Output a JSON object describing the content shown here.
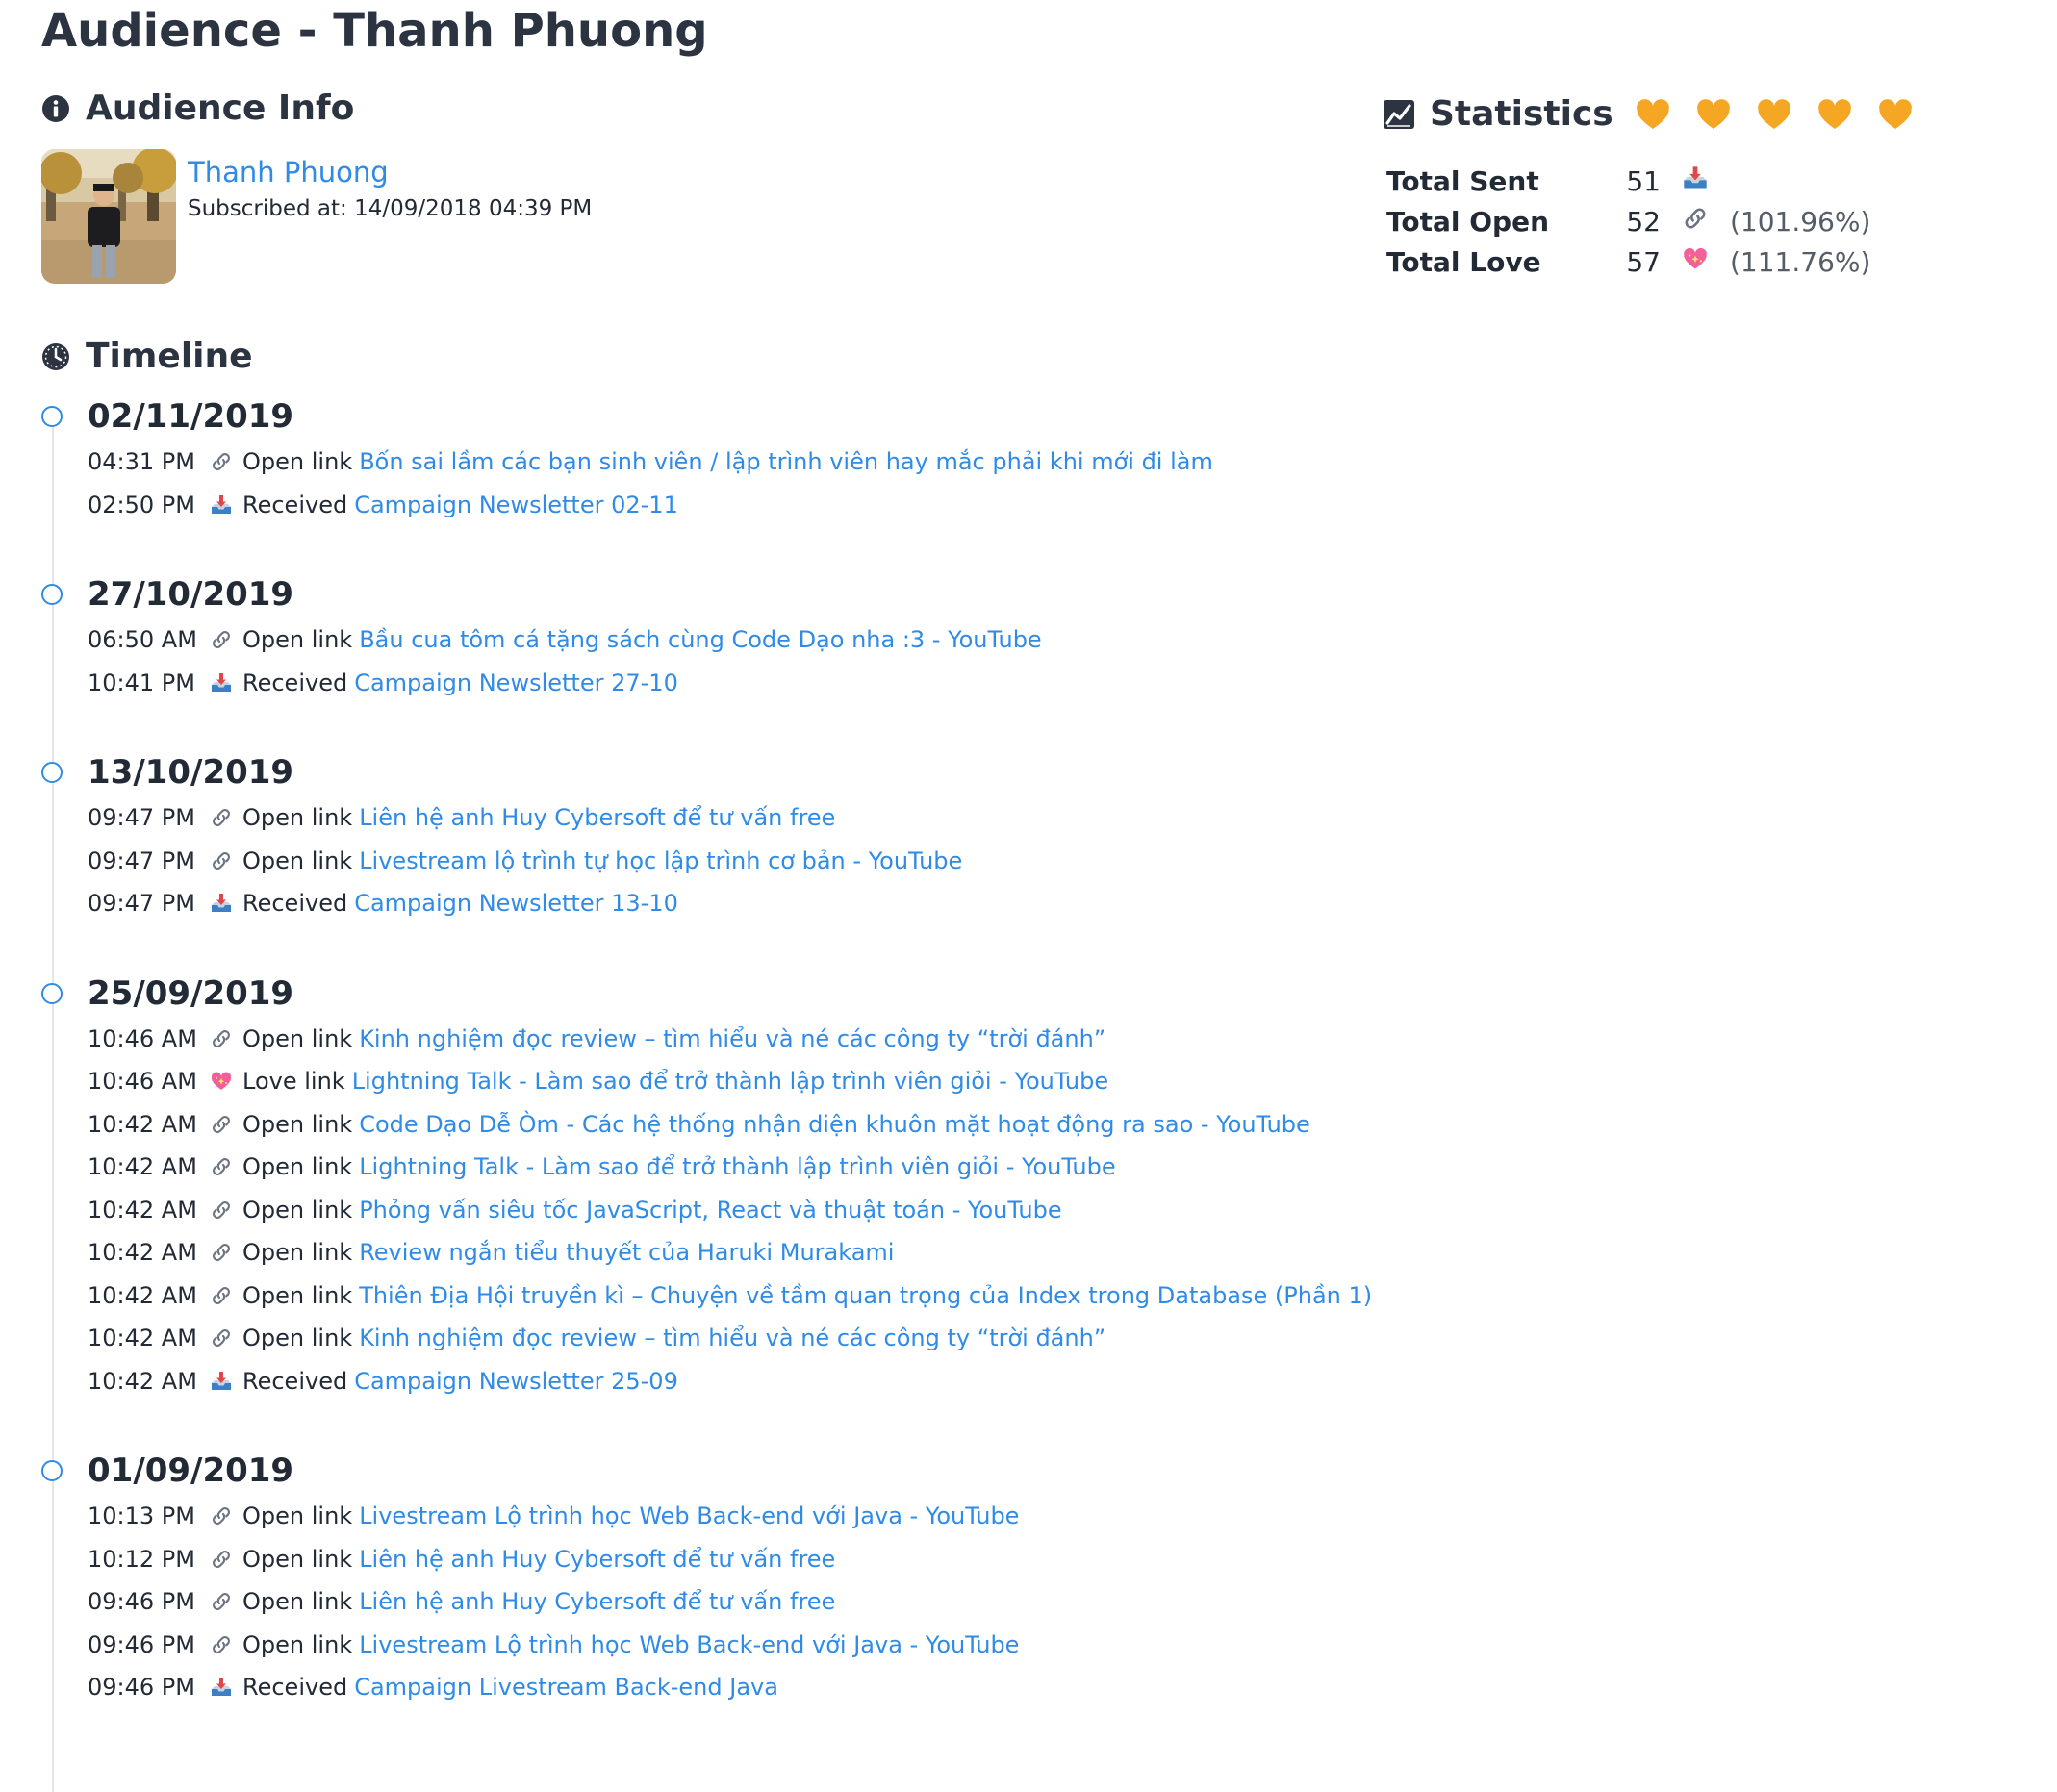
{
  "page": {
    "title": "Audience - Thanh Phuong"
  },
  "audience": {
    "heading": "Audience Info",
    "name": "Thanh Phuong",
    "subscribed": "Subscribed at: 14/09/2018 04:39 PM"
  },
  "statistics": {
    "heading": "Statistics",
    "hearts": 5,
    "rows": [
      {
        "label": "Total Sent",
        "value": "51",
        "icon": "inbox-tray-icon",
        "pct": ""
      },
      {
        "label": "Total Open",
        "value": "52",
        "icon": "link-icon",
        "pct": "(101.96%)"
      },
      {
        "label": "Total Love",
        "value": "57",
        "icon": "sparkling-heart-icon",
        "pct": "(111.76%)"
      }
    ]
  },
  "timeline": {
    "heading": "Timeline",
    "groups": [
      {
        "date": "02/11/2019",
        "events": [
          {
            "time": "04:31 PM",
            "icon": "link-icon",
            "action": "Open link",
            "target": "Bốn sai lầm các bạn sinh viên / lập trình viên hay mắc phải khi mới đi làm"
          },
          {
            "time": "02:50 PM",
            "icon": "inbox-tray-icon",
            "action": "Received",
            "target": "Campaign Newsletter 02-11"
          }
        ]
      },
      {
        "date": "27/10/2019",
        "events": [
          {
            "time": "06:50 AM",
            "icon": "link-icon",
            "action": "Open link",
            "target": "Bầu cua tôm cá tặng sách cùng Code Dạo nha :3 - YouTube"
          },
          {
            "time": "10:41 PM",
            "icon": "inbox-tray-icon",
            "action": "Received",
            "target": "Campaign Newsletter 27-10"
          }
        ]
      },
      {
        "date": "13/10/2019",
        "events": [
          {
            "time": "09:47 PM",
            "icon": "link-icon",
            "action": "Open link",
            "target": "Liên hệ anh Huy Cybersoft để tư vấn free"
          },
          {
            "time": "09:47 PM",
            "icon": "link-icon",
            "action": "Open link",
            "target": "Livestream lộ trình tự học lập trình cơ bản - YouTube"
          },
          {
            "time": "09:47 PM",
            "icon": "inbox-tray-icon",
            "action": "Received",
            "target": "Campaign Newsletter 13-10"
          }
        ]
      },
      {
        "date": "25/09/2019",
        "events": [
          {
            "time": "10:46 AM",
            "icon": "link-icon",
            "action": "Open link",
            "target": "Kinh nghiệm đọc review – tìm hiểu và né các công ty “trời đánh”"
          },
          {
            "time": "10:46 AM",
            "icon": "sparkling-heart-icon",
            "action": "Love link",
            "target": "Lightning Talk - Làm sao để trở thành lập trình viên giỏi - YouTube"
          },
          {
            "time": "10:42 AM",
            "icon": "link-icon",
            "action": "Open link",
            "target": "Code Dạo Dễ Òm - Các hệ thống nhận diện khuôn mặt hoạt động ra sao - YouTube"
          },
          {
            "time": "10:42 AM",
            "icon": "link-icon",
            "action": "Open link",
            "target": "Lightning Talk - Làm sao để trở thành lập trình viên giỏi - YouTube"
          },
          {
            "time": "10:42 AM",
            "icon": "link-icon",
            "action": "Open link",
            "target": "Phỏng vấn siêu tốc JavaScript, React và thuật toán - YouTube"
          },
          {
            "time": "10:42 AM",
            "icon": "link-icon",
            "action": "Open link",
            "target": "Review ngắn tiểu thuyết của Haruki Murakami"
          },
          {
            "time": "10:42 AM",
            "icon": "link-icon",
            "action": "Open link",
            "target": "Thiên Địa Hội truyền kì – Chuyện về tầm quan trọng của Index trong Database (Phần 1)"
          },
          {
            "time": "10:42 AM",
            "icon": "link-icon",
            "action": "Open link",
            "target": "Kinh nghiệm đọc review – tìm hiểu và né các công ty “trời đánh”"
          },
          {
            "time": "10:42 AM",
            "icon": "inbox-tray-icon",
            "action": "Received",
            "target": "Campaign Newsletter 25-09"
          }
        ]
      },
      {
        "date": "01/09/2019",
        "events": [
          {
            "time": "10:13 PM",
            "icon": "link-icon",
            "action": "Open link",
            "target": "Livestream Lộ trình học Web Back-end với Java - YouTube"
          },
          {
            "time": "10:12 PM",
            "icon": "link-icon",
            "action": "Open link",
            "target": "Liên hệ anh Huy Cybersoft để tư vấn free"
          },
          {
            "time": "09:46 PM",
            "icon": "link-icon",
            "action": "Open link",
            "target": "Liên hệ anh Huy Cybersoft để tư vấn free"
          },
          {
            "time": "09:46 PM",
            "icon": "link-icon",
            "action": "Open link",
            "target": "Livestream Lộ trình học Web Back-end với Java - YouTube"
          },
          {
            "time": "09:46 PM",
            "icon": "inbox-tray-icon",
            "action": "Received",
            "target": "Campaign Livestream Back-end Java"
          }
        ]
      }
    ]
  },
  "colors": {
    "accent": "#2f8be6",
    "heart": "#f5a623",
    "text": "#222a35"
  }
}
